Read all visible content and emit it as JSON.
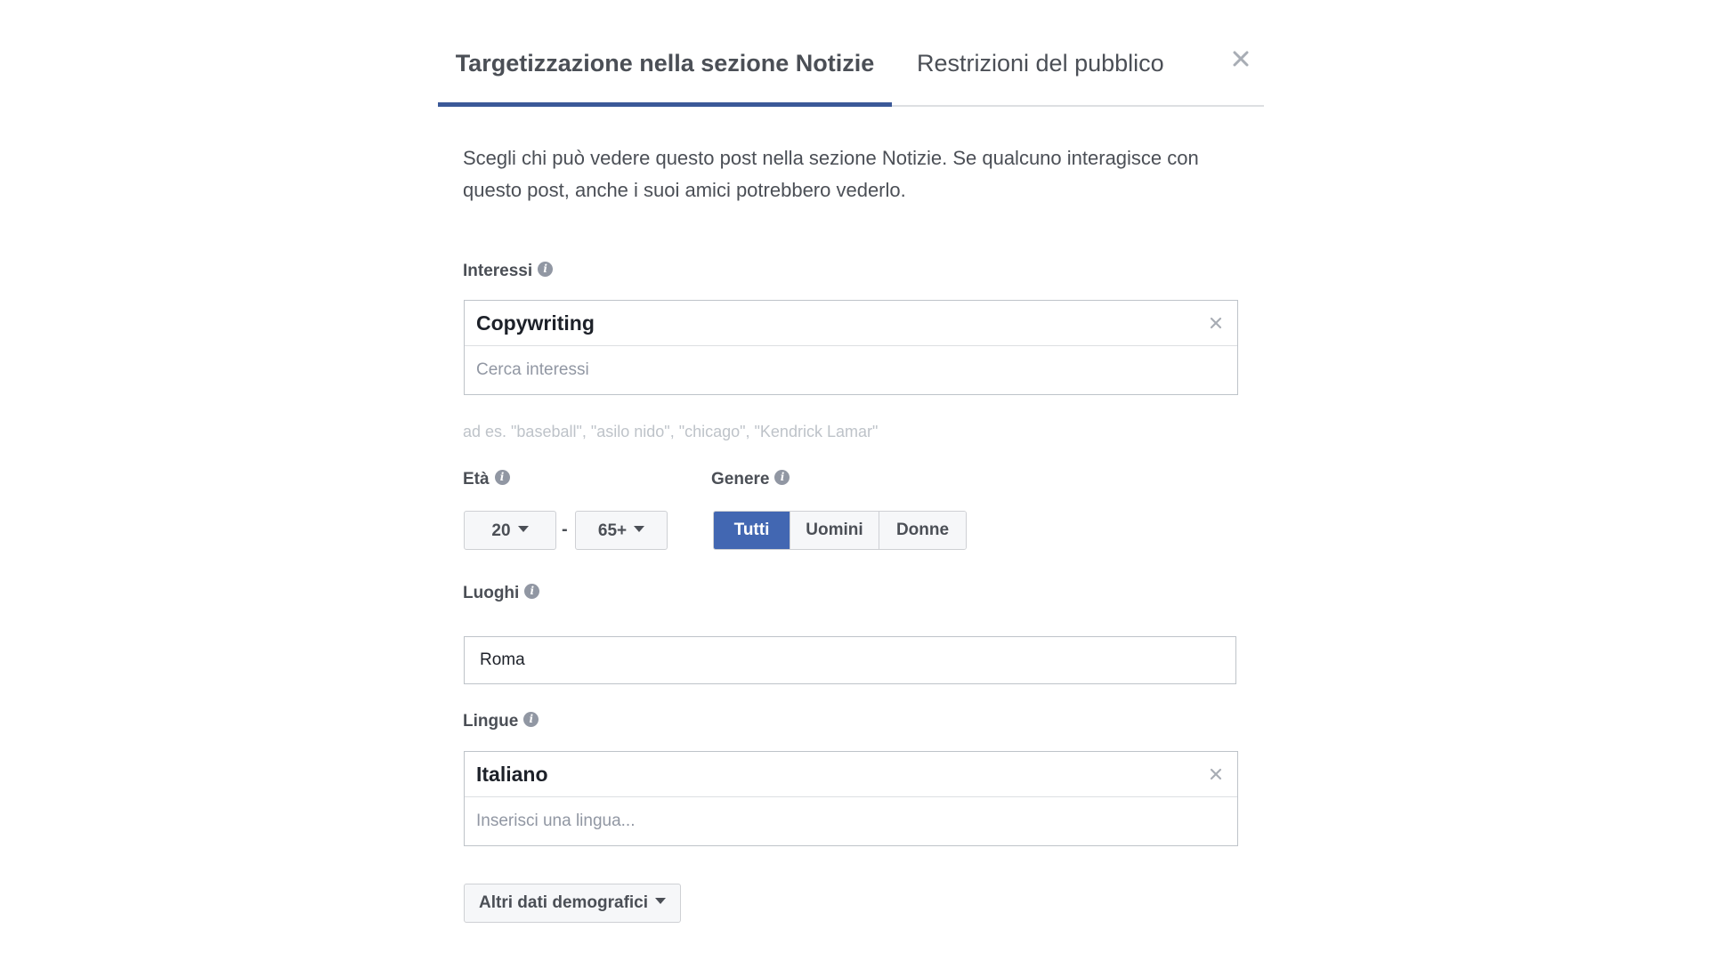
{
  "tabs": {
    "active_label": "Targetizzazione nella sezione Notizie",
    "inactive_label": "Restrizioni del pubblico"
  },
  "description": "Scegli chi può vedere questo post nella sezione Notizie. Se qualcuno interagisce con questo post, anche i suoi amici potrebbero vederlo.",
  "interests": {
    "label": "Interessi",
    "selected": "Copywriting",
    "placeholder": "Cerca interessi",
    "hint": "ad es. \"baseball\", \"asilo nido\", \"chicago\", \"Kendrick Lamar\""
  },
  "age": {
    "label": "Età",
    "min": "20",
    "separator": "-",
    "max": "65+"
  },
  "gender": {
    "label": "Genere",
    "options": [
      "Tutti",
      "Uomini",
      "Donne"
    ],
    "selected": "Tutti"
  },
  "locations": {
    "label": "Luoghi",
    "value": "Roma"
  },
  "languages": {
    "label": "Lingue",
    "selected": "Italiano",
    "placeholder": "Inserisci una lingua..."
  },
  "more_demographics": {
    "label": "Altri dati demografici"
  },
  "colors": {
    "accent": "#3b5998",
    "selected_button": "#4267b2",
    "text": "#4b4f56"
  },
  "icons": {
    "close": "close-icon",
    "info": "info-icon",
    "dropdown": "caret-down-icon",
    "remove": "remove-token-icon"
  }
}
